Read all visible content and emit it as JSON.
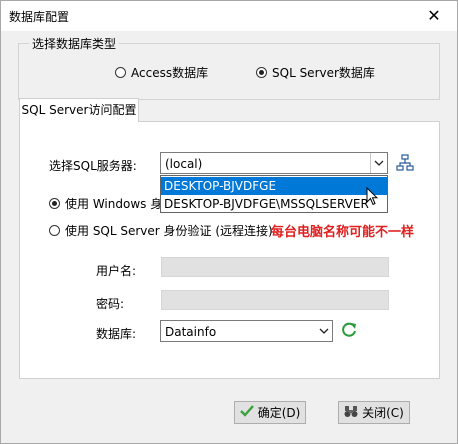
{
  "window": {
    "title": "数据库配置",
    "close_glyph": "✕"
  },
  "db_type": {
    "legend": "选择数据库类型",
    "options": [
      {
        "label": "Access数据库",
        "selected": false
      },
      {
        "label": "SQL Server数据库",
        "selected": true
      }
    ]
  },
  "tab": {
    "label": "SQL Server访问配置"
  },
  "server": {
    "label": "选择SQL服务器:",
    "value": "(local)",
    "dropdown_items": [
      "DESKTOP-BJVDFGE",
      "DESKTOP-BJVDFGE\\MSSQLSERVER"
    ],
    "highlighted_index": 0
  },
  "auth": {
    "windows_label": "使用 Windows 身份",
    "sql_label": "使用 SQL Server 身份验证 (远程连接)",
    "windows_selected": true
  },
  "annotation": "每台电脑名称可能不一样",
  "credentials": {
    "username_label": "用户名:",
    "password_label": "密码:",
    "username_value": "",
    "password_value": ""
  },
  "database": {
    "label": "数据库:",
    "value": "Datainfo"
  },
  "buttons": {
    "ok": "确定(D)",
    "close": "关闭(C)"
  },
  "colors": {
    "selection": "#0078d7",
    "annotation": "#e02020",
    "refresh": "#2a9a3a",
    "ok_check": "#3aa23a"
  },
  "icons": [
    "close-icon",
    "network-icon",
    "chevron-down-icon",
    "refresh-icon",
    "checkmark-icon",
    "binoculars-icon",
    "mouse-cursor-icon"
  ]
}
